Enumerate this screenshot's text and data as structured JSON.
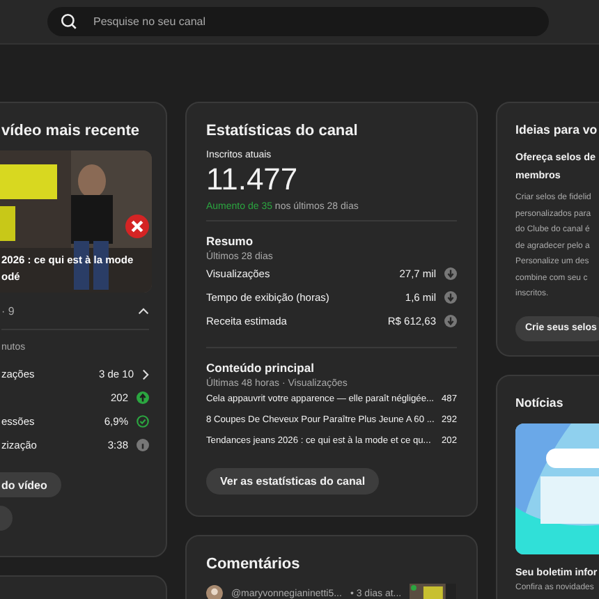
{
  "search": {
    "placeholder": "Pesquise no seu canal"
  },
  "latest_video": {
    "title": "vídeo mais recente",
    "overlay_lines": [
      "2026 : ce qui est à la mode",
      "odé"
    ],
    "meta": "· 9",
    "expanded": true,
    "period": "nutos",
    "rows": [
      {
        "label": "zações",
        "value": "3 de 10",
        "kind": "link"
      },
      {
        "label": "",
        "value": "202",
        "kind": "up"
      },
      {
        "label": "essões",
        "value": "6,9%",
        "kind": "check"
      },
      {
        "label": "zização",
        "value": "3:38",
        "kind": "info"
      }
    ],
    "buttons": [
      "do vídeo"
    ]
  },
  "channel_stats": {
    "title": "Estatísticas do canal",
    "subscribers_label": "Inscritos atuais",
    "subscribers": "11.477",
    "increase": "Aumento de 35",
    "increase_rest": " nos últimos 28 dias",
    "summary": {
      "title": "Resumo",
      "period": "Últimos 28 dias",
      "rows": [
        {
          "label": "Visualizações",
          "value": "27,7 mil"
        },
        {
          "label": "Tempo de exibição (horas)",
          "value": "1,6 mil"
        },
        {
          "label": "Receita estimada",
          "value": "R$ 612,63"
        }
      ]
    },
    "top_content": {
      "title": "Conteúdo principal",
      "period": "Últimas 48 horas · Visualizações",
      "rows": [
        {
          "title": "Cela appauvrit votre apparence — elle paraît négligée...",
          "value": "487"
        },
        {
          "title": "8 Coupes De Cheveux Pour Paraître Plus Jeune A 60 ...",
          "value": "292"
        },
        {
          "title": "Tendances jeans 2026 : ce qui est à la mode et ce qu...",
          "value": "202"
        }
      ]
    },
    "button": "Ver as estatísticas do canal"
  },
  "comments": {
    "title": "Comentários",
    "items": [
      {
        "author": "@maryvonnegianinetti5...",
        "time": "• 3 dias at..."
      }
    ]
  },
  "ideas": {
    "title": "Ideias para vo",
    "heading_lines": [
      "Ofereça selos de",
      "membros"
    ],
    "body_lines": [
      "Criar selos de fidelid",
      "personalizados para",
      "do Clube do canal é",
      "de agradecer pelo a",
      "Personalize um des",
      "combine com seu c",
      "inscritos."
    ],
    "button": "Crie seus selos"
  },
  "news": {
    "title": "Notícias",
    "heading": "Seu boletim infor",
    "body": "Confira as novidades"
  }
}
